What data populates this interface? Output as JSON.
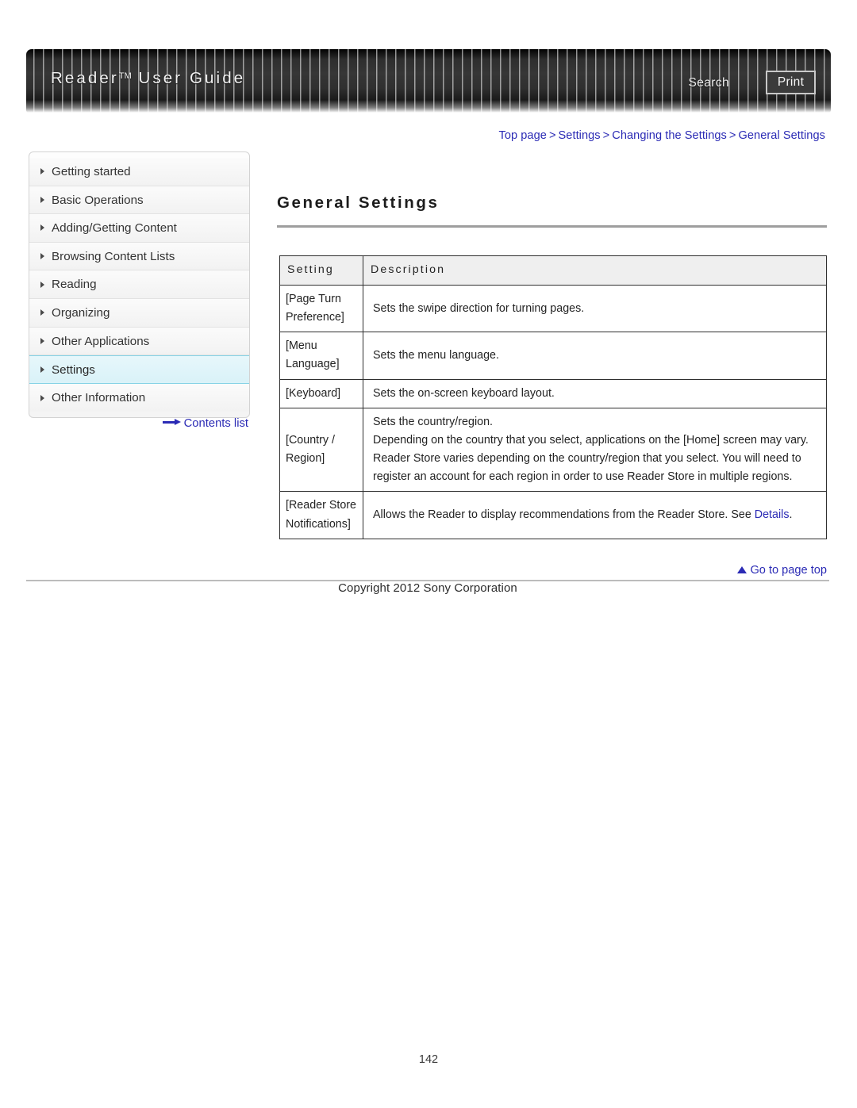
{
  "header": {
    "brand": "Reader",
    "brand_tm": "TM",
    "brand_suffix": " User Guide",
    "search_label": "Search",
    "print_label": "Print"
  },
  "breadcrumb": {
    "separator": ">",
    "items": [
      "Top page",
      "Settings",
      "Changing the Settings",
      "General Settings"
    ]
  },
  "sidebar": {
    "items": [
      {
        "label": "Getting started",
        "active": false
      },
      {
        "label": "Basic Operations",
        "active": false
      },
      {
        "label": "Adding/Getting Content",
        "active": false
      },
      {
        "label": "Browsing Content Lists",
        "active": false
      },
      {
        "label": "Reading",
        "active": false
      },
      {
        "label": "Organizing",
        "active": false
      },
      {
        "label": "Other Applications",
        "active": false
      },
      {
        "label": "Settings",
        "active": true
      },
      {
        "label": "Other Information",
        "active": false
      }
    ],
    "contents_list_label": "Contents list"
  },
  "main": {
    "title": "General Settings",
    "table": {
      "headers": [
        "Setting",
        "Description"
      ],
      "rows": [
        {
          "setting": "[Page Turn Preference]",
          "description": [
            "Sets the swipe direction for turning pages."
          ]
        },
        {
          "setting": "[Menu Language]",
          "description": [
            "Sets the menu language."
          ]
        },
        {
          "setting": "[Keyboard]",
          "description": [
            "Sets the on-screen keyboard layout."
          ]
        },
        {
          "setting": "[Country / Region]",
          "description": [
            "Sets the country/region.",
            "Depending on the country that you select, applications on the [Home] screen may vary.",
            "Reader Store varies depending on the country/region that you select. You will need to register an account for each region in order to use Reader Store in multiple regions."
          ]
        },
        {
          "setting": "[Reader Store Notifications]",
          "description_prefix": "Allows the Reader to display recommendations from the Reader Store. See ",
          "description_link": "Details",
          "description_suffix": "."
        }
      ]
    }
  },
  "footer": {
    "go_to_top_label": "Go to page top",
    "copyright": "Copyright 2012 Sony Corporation",
    "page_number": "142"
  },
  "colors": {
    "link": "#2b2bb5",
    "active_nav_bg": "#d9f2f8",
    "header_dark": "#2e2e2e",
    "table_header_bg": "#efefef"
  }
}
